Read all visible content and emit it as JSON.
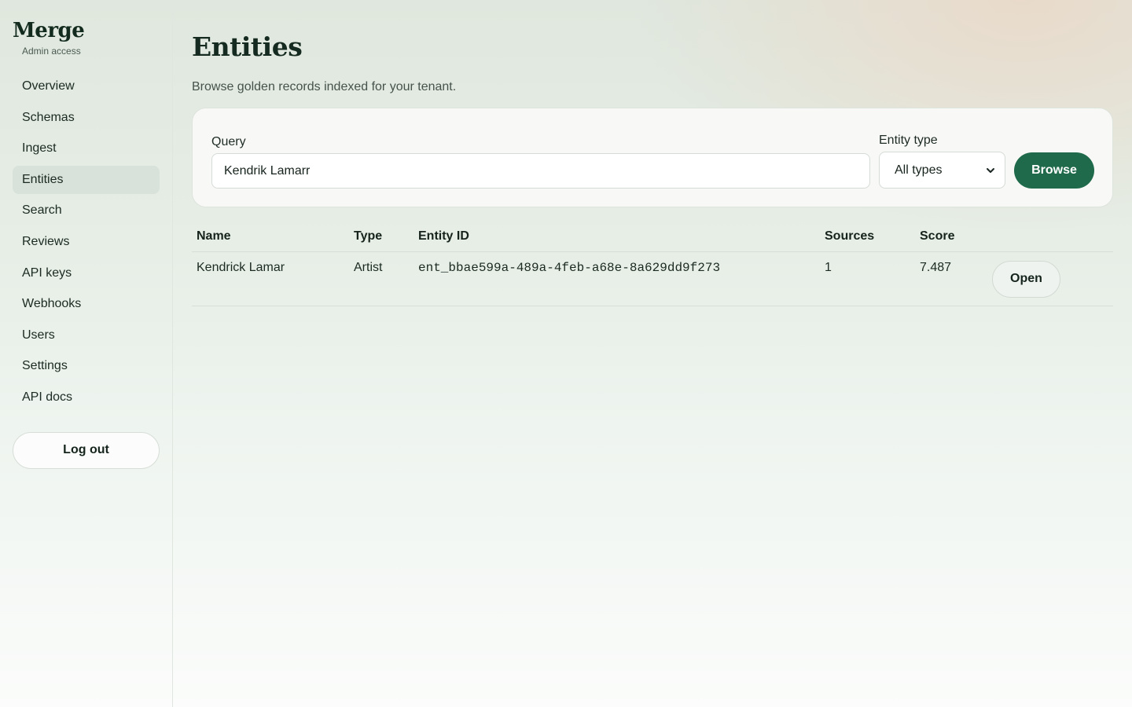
{
  "brand": {
    "name": "Merge",
    "subtitle": "Admin access"
  },
  "sidebar": {
    "items": [
      {
        "label": "Overview"
      },
      {
        "label": "Schemas"
      },
      {
        "label": "Ingest"
      },
      {
        "label": "Entities",
        "active": true
      },
      {
        "label": "Search"
      },
      {
        "label": "Reviews"
      },
      {
        "label": "API keys"
      },
      {
        "label": "Webhooks"
      },
      {
        "label": "Users"
      },
      {
        "label": "Settings"
      },
      {
        "label": "API docs"
      }
    ],
    "logout_label": "Log out"
  },
  "page": {
    "title": "Entities",
    "subtitle": "Browse golden records indexed for your tenant."
  },
  "filters": {
    "query_label": "Query",
    "query_value": "Kendrik Lamarr",
    "entity_type_label": "Entity type",
    "entity_type_value": "All types",
    "browse_label": "Browse"
  },
  "table": {
    "columns": [
      "Name",
      "Type",
      "Entity ID",
      "Sources",
      "Score"
    ],
    "rows": [
      {
        "name": "Kendrick Lamar",
        "type": "Artist",
        "entity_id": "ent_bbae599a-489a-4feb-a68e-8a629dd9f273",
        "sources": "1",
        "score": "7.487",
        "action_label": "Open"
      }
    ]
  },
  "colors": {
    "accent": "#1f6a4a",
    "active_nav_bg": "#d8e2da"
  }
}
